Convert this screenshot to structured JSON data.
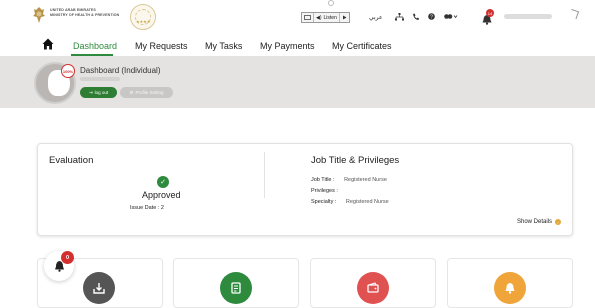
{
  "header": {
    "ministry_line1": "UNITED ARAB EMIRATES",
    "ministry_line2": "MINISTRY OF HEALTH & PREVENTION",
    "listen_label": "Listen",
    "language_label": "عربي",
    "notification_count": "14"
  },
  "nav": {
    "tabs": [
      {
        "label": "Dashboard",
        "active": true
      },
      {
        "label": "My Requests"
      },
      {
        "label": "My Tasks"
      },
      {
        "label": "My Payments"
      },
      {
        "label": "My Certificates"
      }
    ]
  },
  "profile": {
    "title": "Dashboard (Individual)",
    "completion": "100%",
    "logout_label": "log out",
    "profile_setting_label": "Profile Setting"
  },
  "evaluation": {
    "heading": "Evaluation",
    "status": "Approved",
    "issue_date_label": "Issue Date : 2"
  },
  "job": {
    "heading": "Job Title & Privileges",
    "job_title_label": "Job Title :",
    "job_title_value": "Registered Nurse",
    "privileges_label": "Privileges :",
    "privileges_value": "",
    "specialty_label": "Specialty :",
    "specialty_value": "Registered Nurse",
    "show_details_label": "Show Details"
  },
  "notifications": {
    "count": "0"
  },
  "colors": {
    "brand_green": "#2e8b3e",
    "tile_gray": "#555555",
    "tile_green": "#2e8b3e",
    "tile_red": "#e05252",
    "tile_orange": "#f0a53a"
  }
}
